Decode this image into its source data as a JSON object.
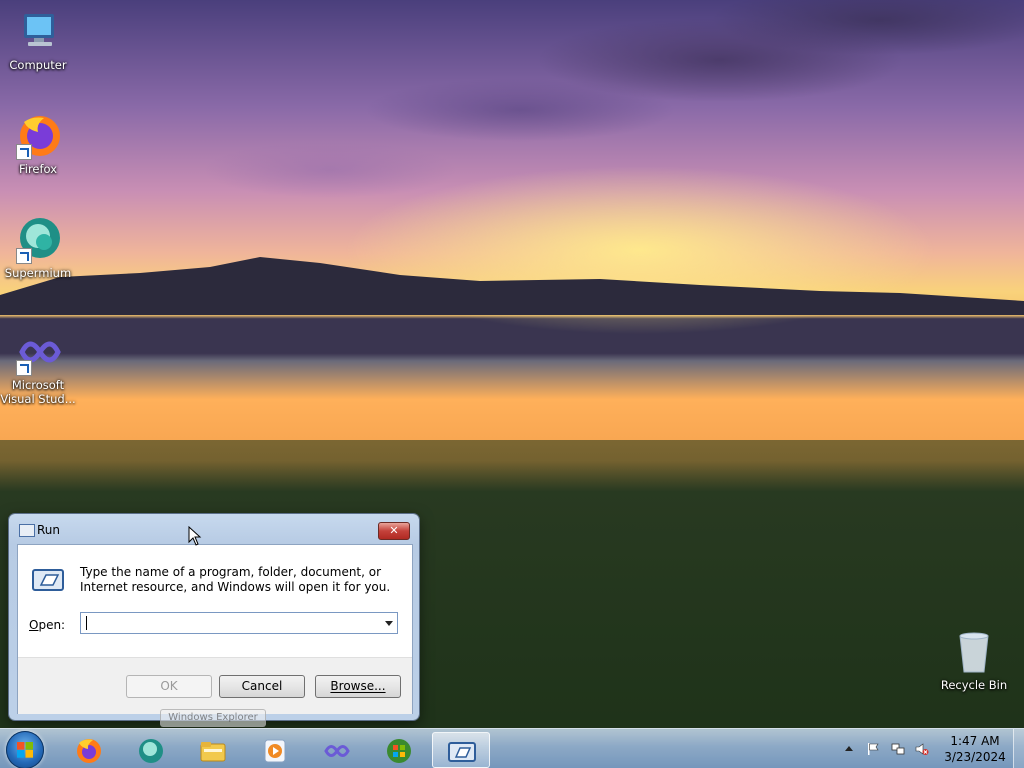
{
  "desktop": {
    "icons": [
      {
        "label": "Computer",
        "icon": "computer-icon"
      },
      {
        "label": "Firefox",
        "icon": "firefox-icon"
      },
      {
        "label": "Supermium",
        "icon": "supermium-icon"
      },
      {
        "label": "Microsoft Visual Stud...",
        "label_line1": "Microsoft",
        "label_line2": "Visual Stud...",
        "icon": "visual-studio-icon"
      },
      {
        "label": "Recycle Bin",
        "icon": "recycle-bin-icon"
      }
    ]
  },
  "run_dialog": {
    "title": "Run",
    "close_label": "✕",
    "description": "Type the name of a program, folder, document, or Internet resource, and Windows will open it for you.",
    "open_label_prefix": "",
    "open_label_mnemonic": "O",
    "open_label_rest": "pen:",
    "open_value": "",
    "ok_label": "OK",
    "cancel_label": "Cancel",
    "browse_label": "Browse...",
    "ghost_tooltip": "Windows Explorer"
  },
  "taskbar": {
    "pinned": [
      {
        "name": "firefox",
        "icon": "firefox-icon"
      },
      {
        "name": "supermium",
        "icon": "supermium-icon"
      },
      {
        "name": "explorer",
        "icon": "folder-icon"
      },
      {
        "name": "media-player",
        "icon": "media-player-icon"
      },
      {
        "name": "visual-studio",
        "icon": "visual-studio-icon"
      },
      {
        "name": "windows-update",
        "icon": "windows-logo-icon"
      },
      {
        "name": "run",
        "icon": "run-icon",
        "active": true
      }
    ],
    "time": "1:47 AM",
    "date": "3/23/2024"
  },
  "colors": {
    "taskbar": "#9bb7d8",
    "close_red": "#c4413a",
    "dialog_frame": "#bcd0e8"
  }
}
